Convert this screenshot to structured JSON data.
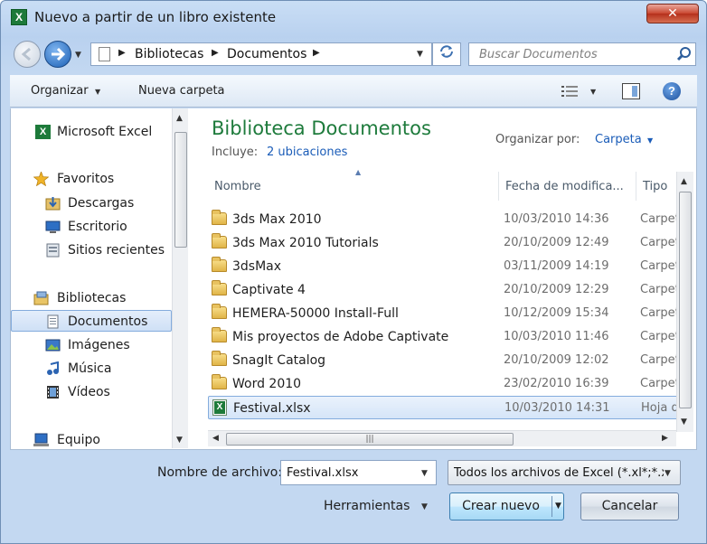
{
  "window": {
    "title": "Nuevo a partir de un libro existente",
    "close_label": "✕"
  },
  "address_bar": {
    "crumbs": [
      "Bibliotecas",
      "Documentos"
    ],
    "search_placeholder": "Buscar Documentos"
  },
  "toolbar": {
    "organize_label": "Organizar",
    "new_folder_label": "Nueva carpeta"
  },
  "nav_pane": {
    "items": [
      {
        "label": "Microsoft Excel",
        "icon": "excel-icon"
      },
      {
        "label": "Favoritos",
        "icon": "star-icon"
      },
      {
        "label": "Descargas",
        "icon": "downloads-icon"
      },
      {
        "label": "Escritorio",
        "icon": "desktop-icon"
      },
      {
        "label": "Sitios recientes",
        "icon": "recent-places-icon"
      },
      {
        "label": "Bibliotecas",
        "icon": "libraries-icon"
      },
      {
        "label": "Documentos",
        "icon": "documents-icon"
      },
      {
        "label": "Imágenes",
        "icon": "pictures-icon"
      },
      {
        "label": "Música",
        "icon": "music-icon"
      },
      {
        "label": "Vídeos",
        "icon": "videos-icon"
      },
      {
        "label": "Equipo",
        "icon": "computer-icon"
      }
    ]
  },
  "library": {
    "title": "Biblioteca Documentos",
    "includes_label": "Incluye:",
    "includes_link": "2 ubicaciones",
    "arrange_label": "Organizar por:",
    "arrange_value": "Carpeta"
  },
  "columns": {
    "name": "Nombre",
    "date": "Fecha de modifica...",
    "type": "Tipo"
  },
  "files": [
    {
      "name": "3ds Max 2010",
      "date": "10/03/2010 14:36",
      "type": "Carpeta de archivos",
      "kind": "folder"
    },
    {
      "name": "3ds Max 2010 Tutorials",
      "date": "20/10/2009 12:49",
      "type": "Carpeta de archivos",
      "kind": "folder"
    },
    {
      "name": "3dsMax",
      "date": "03/11/2009 14:19",
      "type": "Carpeta de archivos",
      "kind": "folder"
    },
    {
      "name": "Captivate 4",
      "date": "20/10/2009 12:29",
      "type": "Carpeta de archivos",
      "kind": "folder"
    },
    {
      "name": "HEMERA-50000 Install-Full",
      "date": "10/12/2009 15:34",
      "type": "Carpeta de archivos",
      "kind": "folder"
    },
    {
      "name": "Mis proyectos de Adobe Captivate",
      "date": "10/03/2010 11:46",
      "type": "Carpeta de archivos",
      "kind": "folder"
    },
    {
      "name": "SnagIt Catalog",
      "date": "20/10/2009 12:02",
      "type": "Carpeta de archivos",
      "kind": "folder"
    },
    {
      "name": "Word 2010",
      "date": "23/02/2010 16:39",
      "type": "Carpeta de archivos",
      "kind": "folder"
    },
    {
      "name": "Festival.xlsx",
      "date": "10/03/2010 14:31",
      "type": "Hoja de cálculo",
      "kind": "xlsx"
    }
  ],
  "footer": {
    "filename_label": "Nombre de archivo:",
    "filename_value": "Festival.xlsx",
    "filetype_value": "Todos los archivos de Excel (*.xl*;*.xlsx;*.xlsm)",
    "tools_label": "Herramientas",
    "create_label": "Crear nuevo",
    "cancel_label": "Cancelar"
  }
}
